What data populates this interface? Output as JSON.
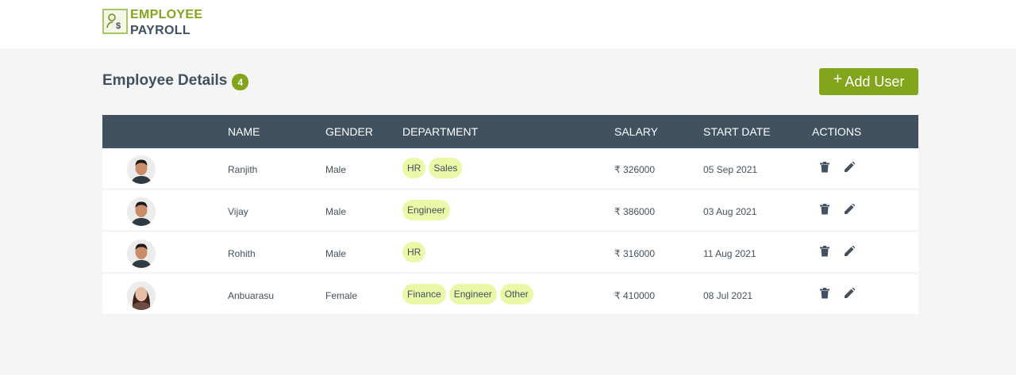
{
  "header": {
    "logo_line1": "EMPLOYEE",
    "logo_line2": "PAYROLL"
  },
  "page": {
    "title": "Employee Details",
    "count": "4",
    "add_button_icon": "+",
    "add_button_label": "Add User"
  },
  "table": {
    "columns": [
      "NAME",
      "GENDER",
      "DEPARTMENT",
      "SALARY",
      "START DATE",
      "ACTIONS"
    ],
    "rows": [
      {
        "name": "Ranjith",
        "gender": "Male",
        "departments": [
          "HR",
          "Sales"
        ],
        "salary": "₹ 326000",
        "start_date": "05 Sep 2021",
        "avatar": "male-avatar"
      },
      {
        "name": "Vijay",
        "gender": "Male",
        "departments": [
          "Engineer"
        ],
        "salary": "₹ 386000",
        "start_date": "03 Aug 2021",
        "avatar": "male-avatar"
      },
      {
        "name": "Rohith",
        "gender": "Male",
        "departments": [
          "HR"
        ],
        "salary": "₹ 316000",
        "start_date": "11 Aug 2021",
        "avatar": "male-avatar"
      },
      {
        "name": "Anbuarasu",
        "gender": "Female",
        "departments": [
          "Finance",
          "Engineer",
          "Other"
        ],
        "salary": "₹ 410000",
        "start_date": "08 Jul 2021",
        "avatar": "female-avatar"
      }
    ],
    "actions": {
      "delete_icon": "trash-icon",
      "edit_icon": "pencil-icon"
    }
  },
  "colors": {
    "accent": "#82a51b",
    "header_bg": "#42515f",
    "tag_bg": "#e9f9a8",
    "page_bg": "#f5f5f5"
  }
}
